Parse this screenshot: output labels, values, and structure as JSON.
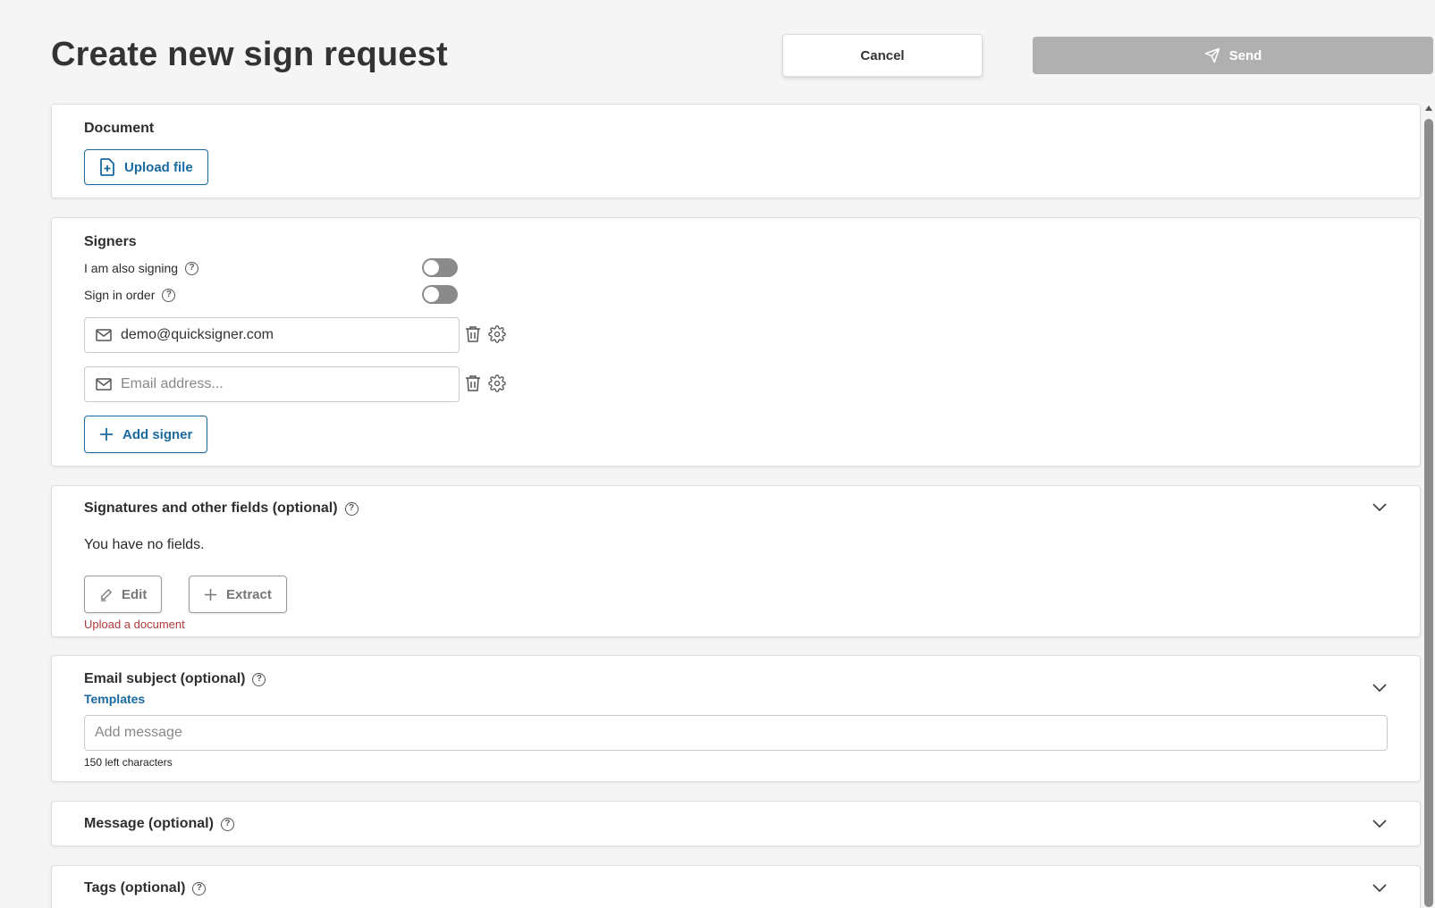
{
  "header": {
    "title": "Create new sign request",
    "cancel_label": "Cancel",
    "send_label": "Send"
  },
  "document": {
    "title": "Document",
    "upload_label": "Upload file"
  },
  "signers": {
    "title": "Signers",
    "also_signing_label": "I am also signing",
    "also_signing_on": false,
    "sign_in_order_label": "Sign in order",
    "sign_in_order_on": false,
    "rows": [
      {
        "value": "demo@quicksigner.com",
        "placeholder": ""
      },
      {
        "value": "",
        "placeholder": "Email address..."
      }
    ],
    "add_signer_label": "Add signer"
  },
  "fields": {
    "title": "Signatures and other fields (optional)",
    "empty_text": "You have no fields.",
    "edit_label": "Edit",
    "extract_label": "Extract",
    "error_text": "Upload a document"
  },
  "email_subject": {
    "title": "Email subject (optional)",
    "templates_link": "Templates",
    "placeholder": "Add message",
    "chars_left": "150 left characters"
  },
  "message": {
    "title": "Message (optional)"
  },
  "tags": {
    "title": "Tags (optional)"
  },
  "colors": {
    "accent": "#1a6aa0",
    "send_disabled": "#b0b0b0",
    "error": "#b23a3a",
    "toggle_off": "#8a8a8a"
  },
  "icons": {
    "help": "?",
    "upload": "file-plus-icon",
    "send": "paper-plane-icon",
    "mail": "mail-icon",
    "delete": "trash-icon",
    "settings": "gear-icon",
    "add": "plus-icon",
    "edit": "pencil-icon",
    "expand": "chevron-down-icon"
  }
}
